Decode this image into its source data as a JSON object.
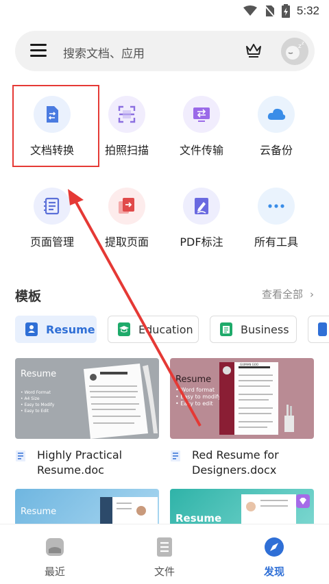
{
  "status": {
    "time": "5:32"
  },
  "search": {
    "placeholder": "搜索文档、应用"
  },
  "tools": [
    {
      "label": "文档转换",
      "icon": "doc-convert-icon",
      "color": "#4a7be0",
      "bg": "#eaf1fd"
    },
    {
      "label": "拍照扫描",
      "icon": "scan-icon",
      "color": "#8b6fe0",
      "bg": "#f1edfd"
    },
    {
      "label": "文件传输",
      "icon": "transfer-icon",
      "color": "#9a6ae8",
      "bg": "#f1edfd"
    },
    {
      "label": "云备份",
      "icon": "cloud-icon",
      "color": "#3a8de8",
      "bg": "#eaf3fd"
    },
    {
      "label": "页面管理",
      "icon": "page-manage-icon",
      "color": "#5a6fd8",
      "bg": "#eceffd"
    },
    {
      "label": "提取页面",
      "icon": "extract-page-icon",
      "color": "#e04a4a",
      "bg": "#fdecec"
    },
    {
      "label": "PDF标注",
      "icon": "pdf-annotate-icon",
      "color": "#6a6ae0",
      "bg": "#eeeefd"
    },
    {
      "label": "所有工具",
      "icon": "more-icon",
      "color": "#3a8de8",
      "bg": "#eaf3fd"
    }
  ],
  "templates": {
    "title": "模板",
    "view_all": "查看全部",
    "chips": [
      {
        "label": "Resume",
        "color": "#2f6fd6",
        "active": true
      },
      {
        "label": "Education",
        "color": "#1eaa6a",
        "active": false
      },
      {
        "label": "Business",
        "color": "#1eaa6a",
        "active": false
      }
    ],
    "cards": [
      {
        "name": "Highly Practical Resume.doc",
        "thumb_title": "Resume",
        "thumb_bullets": [
          "• Word Format",
          "• A4 Size",
          "• Easy to Modify",
          "• Easy to Edit"
        ]
      },
      {
        "name": "Red Resume for Designers.docx",
        "thumb_title": "Resume",
        "thumb_bullets": [
          "• Word format",
          "• Easy to modify",
          "• Easy to edit"
        ],
        "doc_heading": "GUIMAN GOO"
      },
      {
        "thumb_title": "Resume"
      },
      {
        "thumb_title": "Resume"
      }
    ]
  },
  "nav": [
    {
      "label": "最近",
      "icon": "recent-icon"
    },
    {
      "label": "文件",
      "icon": "files-icon"
    },
    {
      "label": "发现",
      "icon": "discover-icon",
      "active": true
    }
  ],
  "colors": {
    "accent": "#2f6fd6",
    "highlight": "#e53935"
  }
}
